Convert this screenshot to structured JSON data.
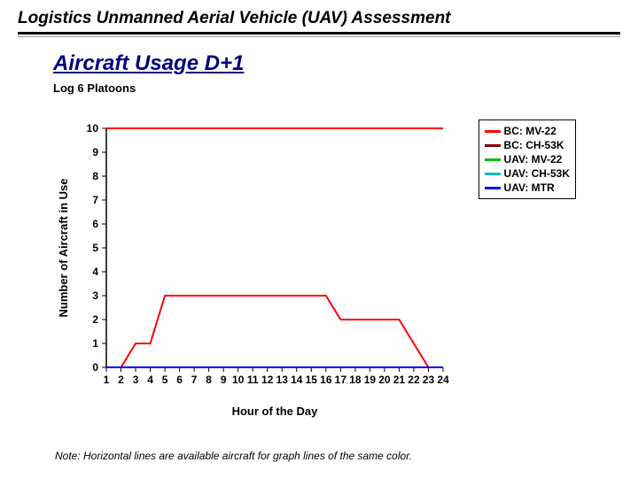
{
  "banner": {
    "title": "Logistics Unmanned Aerial Vehicle (UAV) Assessment"
  },
  "titles": {
    "main": "Aircraft Usage D+1",
    "sub": "Log 6 Platoons",
    "foot": "Note: Horizontal lines are available aircraft for graph lines of the same color."
  },
  "chart_data": {
    "type": "line",
    "xlabel": "Hour of the Day",
    "ylabel": "Number of Aircraft in Use",
    "ylim": [
      0,
      10
    ],
    "x": [
      1,
      2,
      3,
      4,
      5,
      6,
      7,
      8,
      9,
      10,
      11,
      12,
      13,
      14,
      15,
      16,
      17,
      18,
      19,
      20,
      21,
      22,
      23,
      24
    ],
    "series": [
      {
        "name": "BC: MV-22",
        "color": "#ff0000",
        "avail": 10,
        "values": [
          0,
          0,
          1,
          1,
          3,
          3,
          3,
          3,
          3,
          3,
          3,
          3,
          3,
          3,
          3,
          3,
          2,
          2,
          2,
          2,
          2,
          1,
          0,
          0
        ]
      },
      {
        "name": "BC: CH-53K",
        "color": "#800000",
        "avail": null,
        "values": [
          0,
          0,
          0,
          0,
          0,
          0,
          0,
          0,
          0,
          0,
          0,
          0,
          0,
          0,
          0,
          0,
          0,
          0,
          0,
          0,
          0,
          0,
          0,
          0
        ]
      },
      {
        "name": "UAV: MV-22",
        "color": "#00c000",
        "avail": null,
        "values": [
          0,
          0,
          0,
          0,
          0,
          0,
          0,
          0,
          0,
          0,
          0,
          0,
          0,
          0,
          0,
          0,
          0,
          0,
          0,
          0,
          0,
          0,
          0,
          0
        ]
      },
      {
        "name": "UAV: CH-53K",
        "color": "#00c0c0",
        "avail": null,
        "values": [
          0,
          0,
          0,
          0,
          0,
          0,
          0,
          0,
          0,
          0,
          0,
          0,
          0,
          0,
          0,
          0,
          0,
          0,
          0,
          0,
          0,
          0,
          0,
          0
        ]
      },
      {
        "name": "UAV: MTR",
        "color": "#0000ff",
        "avail": null,
        "values": [
          0,
          0,
          0,
          0,
          0,
          0,
          0,
          0,
          0,
          0,
          0,
          0,
          0,
          0,
          0,
          0,
          0,
          0,
          0,
          0,
          0,
          0,
          0,
          0
        ]
      }
    ]
  }
}
